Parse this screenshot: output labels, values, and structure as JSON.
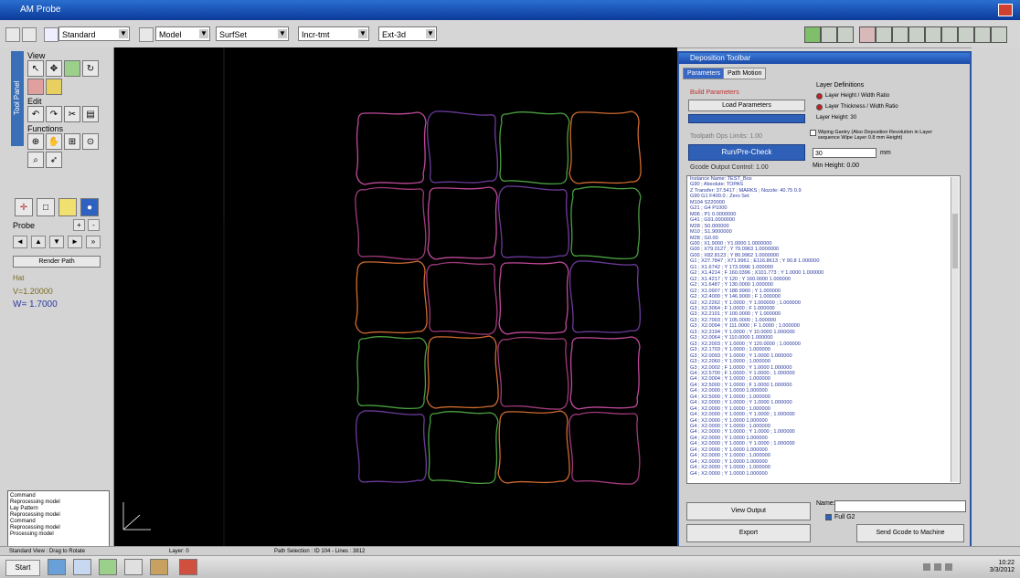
{
  "window": {
    "title": "AM Probe",
    "accent": "#1d4fb0"
  },
  "toolbar": {
    "selects": [
      {
        "label": "Standard"
      },
      {
        "label": "Model"
      },
      {
        "label": "SurfSet"
      },
      {
        "label": "Incr-tmt"
      },
      {
        "label": "Ext-3d"
      }
    ],
    "icons": [
      "new-icon",
      "open-icon",
      "pen-icon",
      "pointer-icon"
    ]
  },
  "left_panel": {
    "vertical_tab": "Tool Panel",
    "sections": {
      "view": "View",
      "edit": "Edit",
      "functions": "Functions",
      "probe": "Probe"
    },
    "readout": {
      "line1": "Hat",
      "line2": "V=1.20000",
      "line3": "W= 1.7000"
    },
    "render_button": "Render Path",
    "log_lines": [
      "Command",
      "Reprocessing model",
      "Lay Pattern",
      "Reprocessing model",
      "Command",
      "Reprocessing model",
      "Processing model"
    ]
  },
  "dialog": {
    "title": "Deposition Toolbar",
    "tabs": [
      "Parameters",
      "Path Motion"
    ],
    "section_label": "Build Parameters",
    "buttons": {
      "generate": "Load Parameters",
      "save_label": "Toolpath Ops Limits: 1.00",
      "run": "Run/Pre-Check",
      "output_label": "Gcode Output Control: 1.00",
      "view_output": "View Output",
      "export": "Export",
      "send_machine": "Send Gcode to Machine"
    },
    "radio_group_label": "Layer Definitions",
    "radios": [
      "Layer Height / Width Ratio",
      "Layer Thickness / Width Ratio"
    ],
    "layer_value": "Layer Height: 30",
    "checkbox_text": "Wiping Gantry (Also Deposition Revolution in Layer sequence Wipe Layer 0.8 mm Height)",
    "input_value": "30",
    "input_unit": "mm",
    "min_height": "Min Height: 0.00",
    "name_label": "Name:",
    "ok_label": "Full G2",
    "code_lines": [
      "Instance Name: TEST_Box",
      "G90 ; Absolute: TOPAS",
      "Z Transfer: 37.5417 ; MARKS ; Nozzle: 40.75 0.9",
      "G90 G1 F400.0 ; Zero Set",
      "M104 S220000",
      "G21 ; G4 P1000",
      "M06 ; P1 0.0000000",
      "G41 ; G91.0000000",
      "M28 ; S0.000000",
      "M10 ; S1.9000000",
      "M28 ; G0.00",
      "G00 ; X1.9000 ; Y1.0000 1.0000000",
      "G00 ; X79.0127 ; Y 79.0963 1.0000000",
      "G00 ; X82.8123 ; Y 80.9962 1.0000000",
      "G1 ; X27.7847 ; X71.9961 ; E116.8613 ; Y 90.8 1.000000",
      "G1 ; X1.6742 ; Y 173.9996 1.000000",
      "G2 ; X1.4214 ; F 160.0396 ; X101.773 ; Y 1.0000 1.000000",
      "G2 ; X1.4217 ; Y 120 ; Y 160.0000 1.000000",
      "G2 ; X1.6487 ; Y 130.0000 1.000000",
      "G2 ; X1.0907 ; Y 188.9960 ; Y 1.000000",
      "G2 ; X2.4000 ; Y 146.9000 ; F 1.000000",
      "G2 ; X2.2262 ; Y 1.0000 ; Y 1.000000 ; 1.000000",
      "G3 ; X2.3064 ; F 1.0000 ; F 1.000000",
      "G3 ; X2.2101 ; Y 100.0000 ; Y 1.000000",
      "G3 ; X2.7003 ; Y 105.0000 ; 1.000000",
      "G3 ; X2.0094 ; Y 111.0000 ; F 1.0000 ; 1.000000",
      "G3 ; X2.3194 ; Y 1.0000 ; Y 10.0000 1.000000",
      "G3 ; X2.0064 ; Y 110.0000 1.000000",
      "G3 ; X2.2003 ; Y 1.0000 ; Y 120.0000 ; 1.000000",
      "G3 ; X2.1703 ; Y 1.0000 ; 1.000000",
      "G3 ; X2.0093 ; Y 1.0000 ; Y 1.0000 1.000000",
      "G3 ; X2.2060 ; Y 1.0000 ; 1.000000",
      "G3 ; X2.0002 ; F 1.0000 ; Y 1.0000 1.000000",
      "G4 ; X2.5700 ; F 1.0000 ; Y 1.0000 ; 1.000000",
      "G4 ; X2.0004 ; Y 1.0000 ; 1.000000",
      "G4 ; X2.5000 ; Y 1.0000 ; F 1.0000 1.000000",
      "G4 ; X2.0000 ; Y 1.0000 1.000000",
      "G4 ; X2.5000 ; Y 1.0000 ; 1.000000",
      "G4 ; X2.0000 ; Y 1.0000 ; Y 1.0000 1.000000",
      "G4 ; X2.0000 ; Y 1.0000 ; 1.000000",
      "G4 ; X2.0000 ; Y 1.0000 ; Y 1.0000 ; 1.000000",
      "G4 ; X2.0000 ; Y 1.0000 1.000000",
      "G4 ; X2.0000 ; Y 1.0000 ; 1.000000",
      "G4 ; X2.0000 ; Y 1.0000 ; Y 1.0000 ; 1.000000",
      "G4 ; X2.0000 ; Y 1.0000 1.000000",
      "G4 ; X2.0000 ; Y 1.0000 ; Y 1.0000 ; 1.000000",
      "G4 ; X2.0000 ; Y 1.0000 1.000000",
      "G4 ; X2.0000 ; Y 1.0000 ; 1.000000",
      "G4 ; X2.0000 ; Y 1.0000 1.000000",
      "G4 ; X2.0000 ; Y 1.0000 ; 1.000000",
      "G4 ; X2.0000 ; Y 1.0000 1.000000"
    ]
  },
  "canvas": {
    "path_colors": [
      "#c04a9a",
      "#6a3a9a",
      "#4aa040",
      "#d06a30",
      "#a03a7a"
    ],
    "background": "#000000"
  },
  "statusbar": {
    "left": "Standard View : Drag to Rotate",
    "mid": "Layer: 0",
    "right": "Path Selection : ID 104 - Lines : 3812"
  },
  "taskbar": {
    "start_label": "Start",
    "clock_time": "10:22",
    "clock_date": "3/3/2012"
  }
}
